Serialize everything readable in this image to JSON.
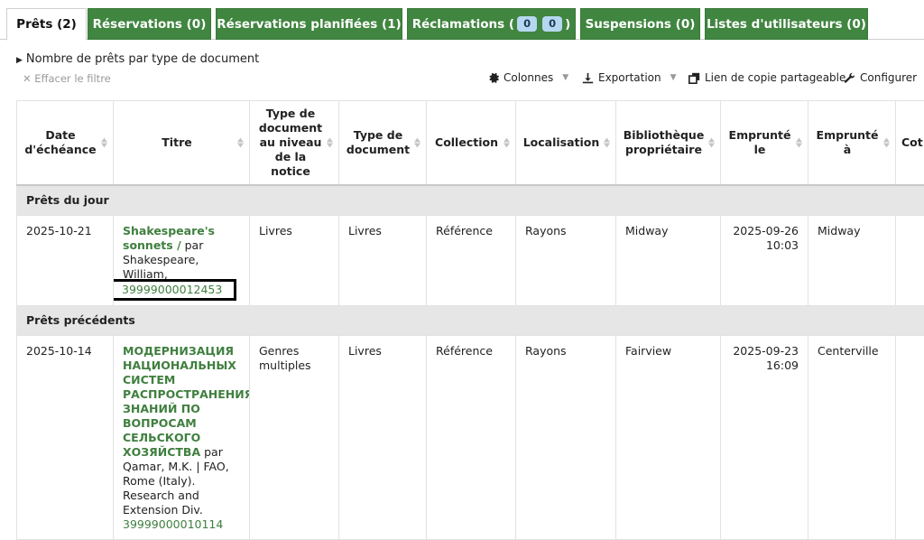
{
  "tabs": [
    {
      "label": "Prêts (2)",
      "active": true
    },
    {
      "label": "Réservations (0)"
    },
    {
      "label": "Réservations planifiées (1)"
    },
    {
      "label_before": "Réclamations (",
      "badge1": "0",
      "badge2": "0",
      "label_after": ")"
    },
    {
      "label": "Suspensions (0)"
    },
    {
      "label": "Listes d'utilisateurs (0)"
    }
  ],
  "summary": "Nombre de prêts par type de document",
  "clear_filter": "Effacer le filtre",
  "toolbar": {
    "columns": "Colonnes",
    "export": "Exportation",
    "share_link": "Lien de copie partageable",
    "configure": "Configurer"
  },
  "columns": [
    "Date d'échéance",
    "Titre",
    "Type de document au niveau de la notice",
    "Type de document",
    "Collection",
    "Localisation",
    "Bibliothèque propriétaire",
    "Emprunté le",
    "Emprunté à",
    "Cot"
  ],
  "groups": {
    "today": "Prêts du jour",
    "previous": "Prêts précédents"
  },
  "rows": [
    {
      "due": "2025-10-21",
      "title": "Shakespeare's sonnets /",
      "by": " par Shakespeare, William,",
      "barcode": "39999000012453",
      "record_type": "Livres",
      "item_type": "Livres",
      "collection": "Référence",
      "location": "Rayons",
      "home_library": "Midway",
      "checkout_date": "2025-09-26",
      "checkout_time": "10:03",
      "checkout_from": "Midway"
    },
    {
      "due": "2025-10-14",
      "title": "МОДЕРНИЗАЦИЯ НАЦИОНАЛЬНЫХ СИСТЕМ РАСПРОСТРАНЕНИЯ ЗНАНИЙ ПО ВОПРОСАМ СЕЛЬСКОГО ХОЗЯЙСТВА",
      "by": " par Qamar, M.K. | FAO, Rome (Italy). Research and Extension Div.",
      "barcode": "39999000010114",
      "record_type": "Genres multiples",
      "item_type": "Livres",
      "collection": "Référence",
      "location": "Rayons",
      "home_library": "Fairview",
      "checkout_date": "2025-09-23",
      "checkout_time": "16:09",
      "checkout_from": "Centerville"
    }
  ]
}
